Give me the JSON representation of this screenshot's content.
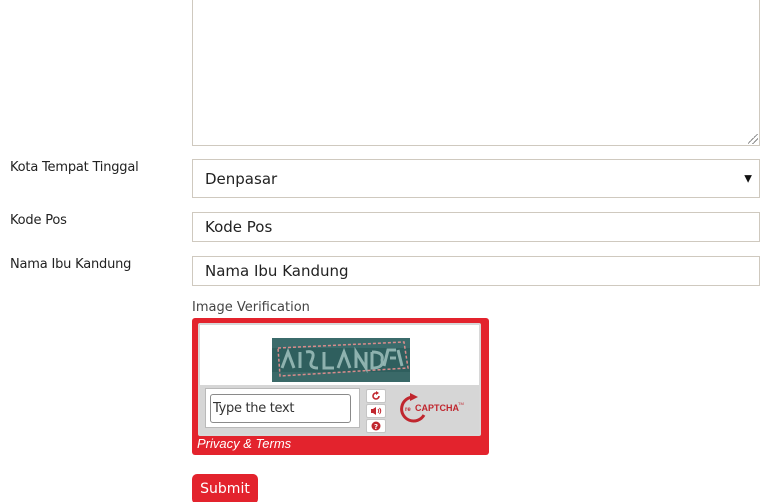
{
  "form": {
    "city": {
      "label": "Kota Tempat Tinggal",
      "value": "Denpasar"
    },
    "postal_code": {
      "label": "Kode Pos",
      "placeholder": "Kode Pos"
    },
    "mother_name": {
      "label": "Nama Ibu Kandung",
      "placeholder": "Nama Ibu Kandung"
    },
    "image_verification_label": "Image Verification",
    "submit_label": "Submit"
  },
  "captcha": {
    "placeholder": "Type the text",
    "logo_text": "reCAPTCHA",
    "logo_mark": "re",
    "privacy_text": "Privacy & Terms",
    "icons": [
      "refresh-icon",
      "audio-icon",
      "help-icon"
    ]
  },
  "colors": {
    "accent": "#e3232d",
    "border": "#cfc9bf"
  }
}
